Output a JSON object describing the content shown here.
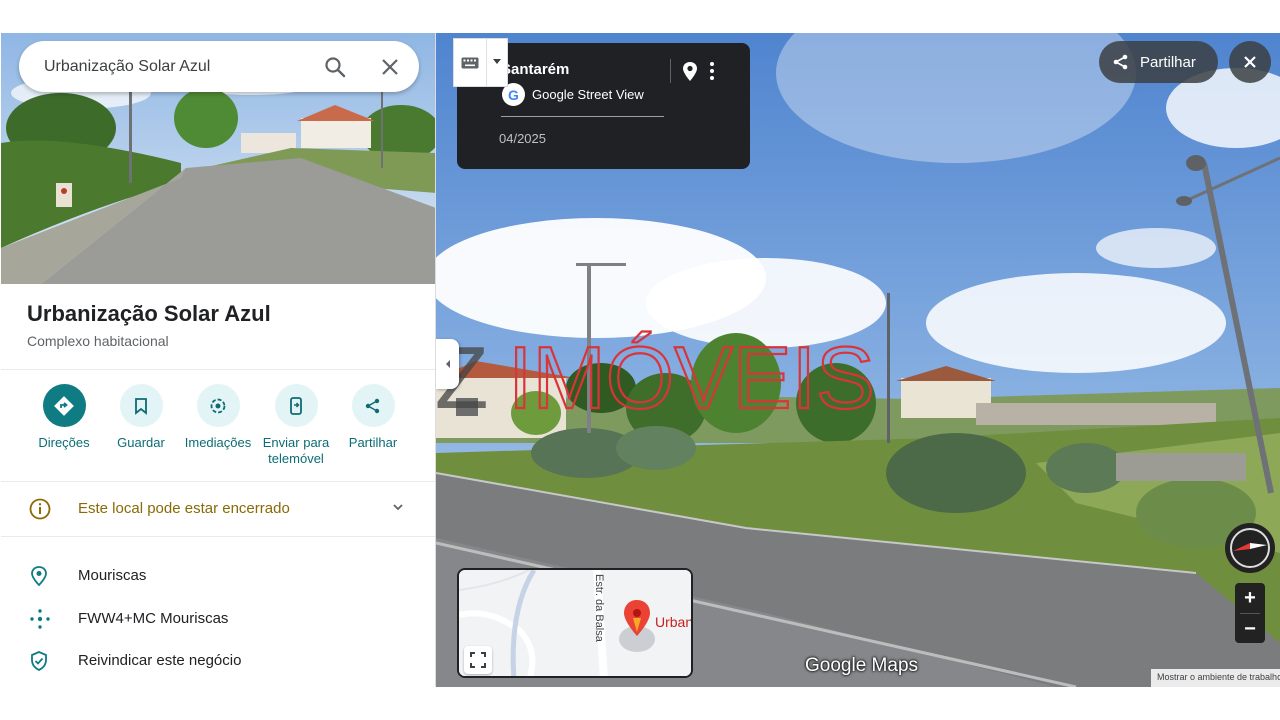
{
  "search": {
    "value": "Urbanização Solar Azul"
  },
  "place": {
    "title": "Urbanização Solar Azul",
    "category": "Complexo habitacional"
  },
  "actions": [
    {
      "label": "Direções",
      "icon": "directions-icon"
    },
    {
      "label": "Guardar",
      "icon": "bookmark-icon"
    },
    {
      "label": "Imediações",
      "icon": "nearby-icon"
    },
    {
      "label": "Enviar para\ntelemóvel",
      "icon": "send-to-phone-icon"
    },
    {
      "label": "Partilhar",
      "icon": "share-icon"
    }
  ],
  "notice": {
    "text": "Este local pode estar encerrado"
  },
  "info": {
    "locality": "Mouriscas",
    "plus_code": "FWW4+MC Mouriscas",
    "claim": "Reivindicar este negócio"
  },
  "street_view": {
    "place": "Santarém",
    "brand": "Google Street View",
    "date": "04/2025",
    "share_label": "Partilhar"
  },
  "watermark": {
    "prefix": "AZ",
    "text": "IMÓVEIS"
  },
  "mini_map": {
    "road_label": "Estr. da Balsa",
    "place_label": "Urbanização Solar Azul"
  },
  "zoom": {
    "in_label": "+",
    "out_label": "−"
  },
  "footer": {
    "logo": "Google Maps",
    "workspace_link": "Mostrar o ambiente de trabalho"
  },
  "colors": {
    "accent_teal": "#0f7b83",
    "warning": "#8a6a05",
    "watermark_red": "#d9343a",
    "watermark_dark": "#444444"
  }
}
